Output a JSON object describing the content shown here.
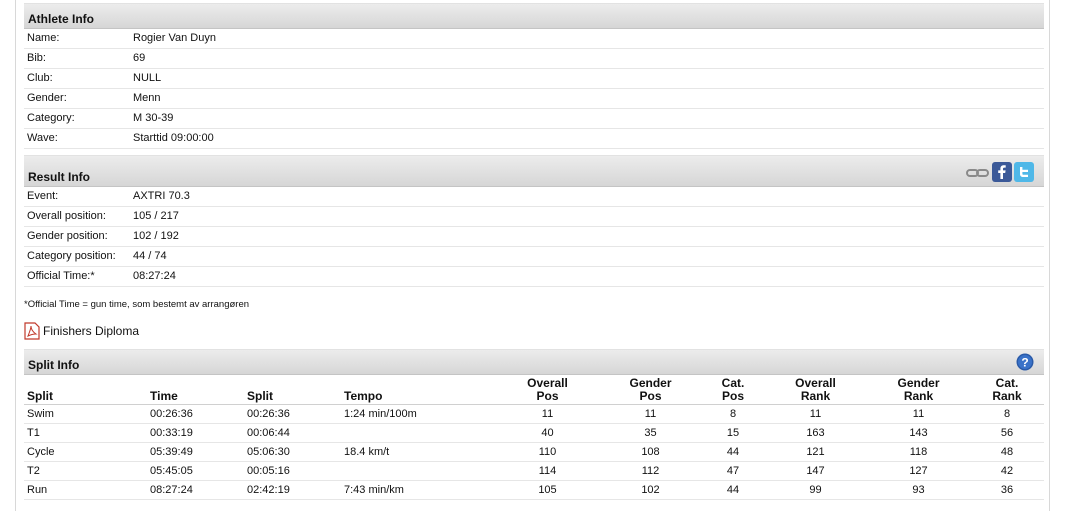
{
  "athlete_info": {
    "title": "Athlete Info",
    "rows": [
      {
        "label": "Name:",
        "value": "Rogier Van Duyn"
      },
      {
        "label": "Bib:",
        "value": "69"
      },
      {
        "label": "Club:",
        "value": "NULL"
      },
      {
        "label": "Gender:",
        "value": "Menn"
      },
      {
        "label": "Category:",
        "value": "M 30-39"
      },
      {
        "label": "Wave:",
        "value": "Starttid 09:00:00"
      }
    ]
  },
  "result_info": {
    "title": "Result Info",
    "share_icons": [
      "link-icon",
      "facebook-icon",
      "twitter-icon"
    ],
    "rows": [
      {
        "label": "Event:",
        "value": "AXTRI 70.3"
      },
      {
        "label": "Overall position:",
        "value": "105 / 217"
      },
      {
        "label": "Gender position:",
        "value": "102 / 192"
      },
      {
        "label": "Category position:",
        "value": "44 / 74"
      },
      {
        "label": "Official Time:*",
        "value": "08:27:24"
      }
    ],
    "note": "*Official Time = gun time, som bestemt av arrangøren",
    "diploma_label": "Finishers Diploma"
  },
  "split_info": {
    "title": "Split Info",
    "help_icon": "help-icon",
    "headers": [
      {
        "l1": "",
        "l2": "Split"
      },
      {
        "l1": "",
        "l2": "Time"
      },
      {
        "l1": "",
        "l2": "Split"
      },
      {
        "l1": "",
        "l2": "Tempo"
      },
      {
        "l1": "Overall",
        "l2": "Pos"
      },
      {
        "l1": "Gender",
        "l2": "Pos"
      },
      {
        "l1": "Cat.",
        "l2": "Pos"
      },
      {
        "l1": "Overall",
        "l2": "Rank"
      },
      {
        "l1": "Gender",
        "l2": "Rank"
      },
      {
        "l1": "Cat.",
        "l2": "Rank"
      }
    ],
    "rows": [
      [
        "Swim",
        "00:26:36",
        "00:26:36",
        "1:24 min/100m",
        "11",
        "11",
        "8",
        "11",
        "11",
        "8"
      ],
      [
        "T1",
        "00:33:19",
        "00:06:44",
        "",
        "40",
        "35",
        "15",
        "163",
        "143",
        "56"
      ],
      [
        "Cycle",
        "05:39:49",
        "05:06:30",
        "18.4 km/t",
        "110",
        "108",
        "44",
        "121",
        "118",
        "48"
      ],
      [
        "T2",
        "05:45:05",
        "00:05:16",
        "",
        "114",
        "112",
        "47",
        "147",
        "127",
        "42"
      ],
      [
        "Run",
        "08:27:24",
        "02:42:19",
        "7:43 min/km",
        "105",
        "102",
        "44",
        "99",
        "93",
        "36"
      ]
    ]
  }
}
